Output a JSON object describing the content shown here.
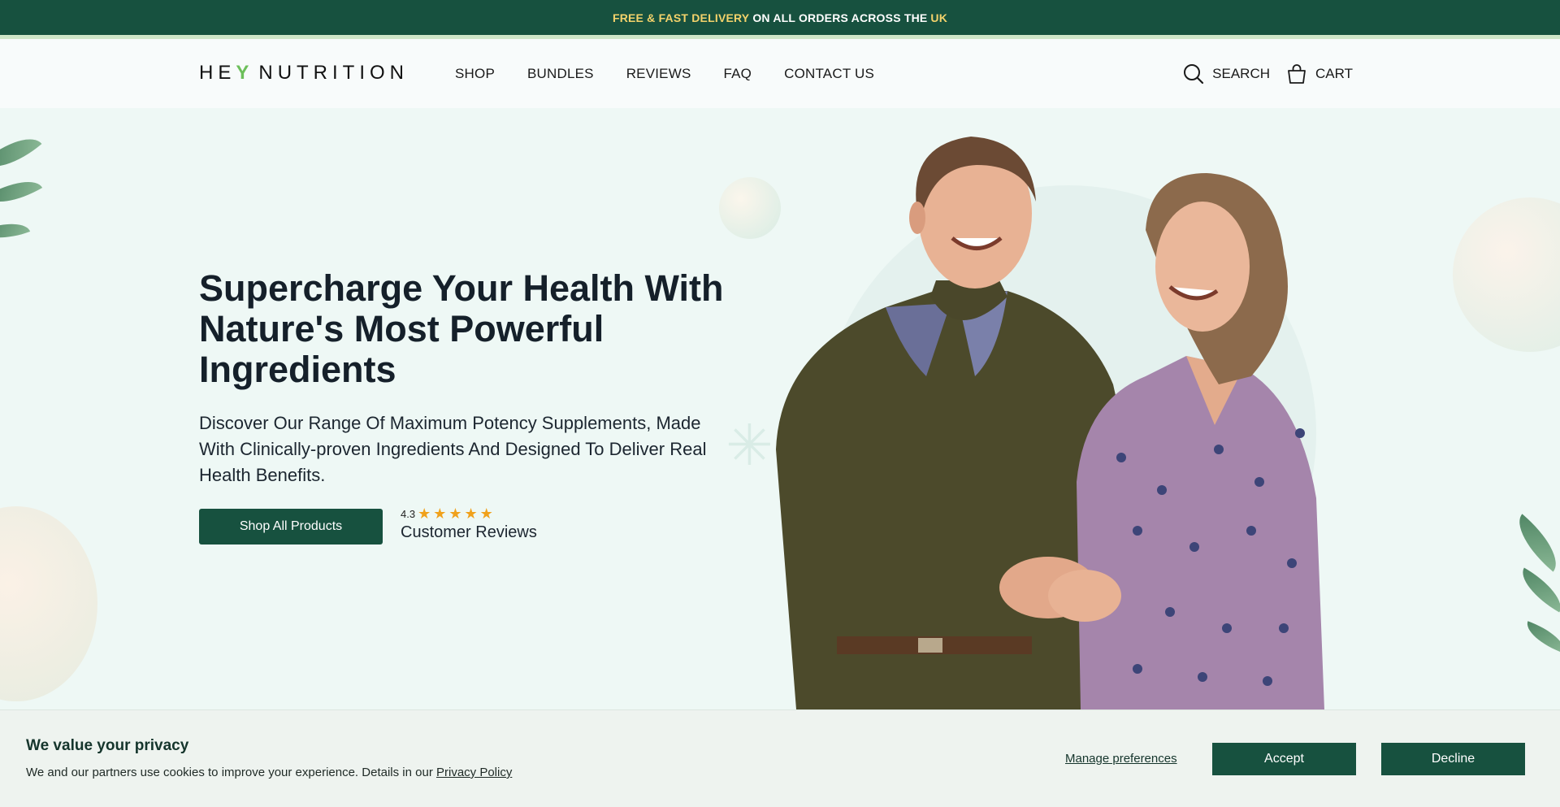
{
  "announcement": {
    "part1": "FREE & FAST DELIVERY",
    "part2": "ON ALL ORDERS ACROSS THE",
    "part3": "UK"
  },
  "header": {
    "logo_left": "HE",
    "logo_mark": "Y",
    "logo_right": "NUTRITION",
    "nav": [
      "SHOP",
      "BUNDLES",
      "REVIEWS",
      "FAQ",
      "CONTACT US"
    ],
    "search_label": "SEARCH",
    "cart_label": "CART"
  },
  "hero": {
    "headline": "Supercharge Your Health With Nature's Most Powerful Ingredients",
    "subtext": "Discover Our Range Of Maximum Potency Supplements, Made With Clinically-proven Ingredients And Designed To Deliver Real Health Benefits.",
    "cta_label": "Shop All Products",
    "rating_value": "4.3",
    "rating_stars": 5,
    "rating_label": "Customer Reviews"
  },
  "cookie": {
    "title": "We value your privacy",
    "text": "We and our partners use cookies to improve your experience. Details in our",
    "policy_link": "Privacy Policy",
    "manage_label": "Manage preferences",
    "accept_label": "Accept",
    "decline_label": "Decline"
  },
  "colors": {
    "brand": "#17513f",
    "highlight": "#f3d26b",
    "hero_bg": "#eef8f5",
    "star": "#f0a11c"
  }
}
